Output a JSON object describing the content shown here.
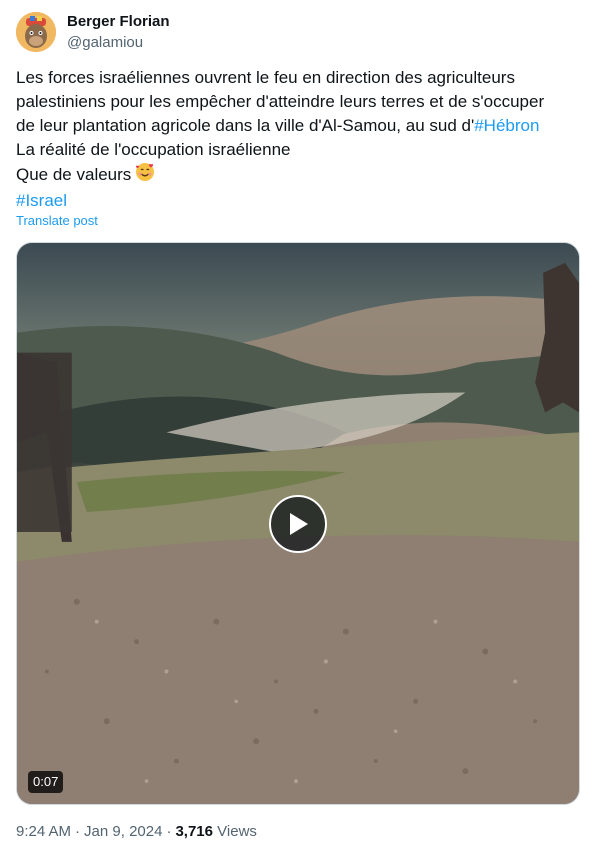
{
  "author": {
    "name": "Berger Florian",
    "handle": "@galamiou"
  },
  "tweet": {
    "line1": "Les forces israéliennes ouvrent le feu en direction des agriculteurs",
    "line2": "palestiniens pour les empêcher d'atteindre leurs terres et de s'occuper",
    "line3_text": "de leur plantation agricole dans la ville d'Al-Samou, au sud d'",
    "line3_tag": "#Hébron",
    "line4": "La réalité de l'occupation israélienne",
    "line5": "Que de valeurs",
    "line6_tag": "#Israel",
    "emoji": "smiling-face-with-hearts"
  },
  "translate_label": "Translate post",
  "video": {
    "duration": "0:07"
  },
  "meta": {
    "time": "9:24 AM",
    "separator": "·",
    "date": "Jan 9, 2024",
    "views_count": "3,716",
    "views_label": "Views"
  },
  "colors": {
    "link": "#1d9bf0",
    "secondary_text": "#536471",
    "primary_text": "#0f1419"
  }
}
